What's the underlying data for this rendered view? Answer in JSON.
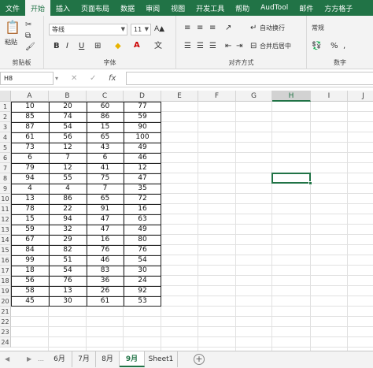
{
  "ribbon_tabs": [
    "文件",
    "开始",
    "插入",
    "页面布局",
    "数据",
    "审阅",
    "视图",
    "开发工具",
    "帮助",
    "AudTool",
    "邮件",
    "方方格子"
  ],
  "active_tab": 1,
  "clipboard": {
    "paste": "粘贴",
    "label": "剪贴板"
  },
  "font": {
    "name": "等线",
    "size": "11",
    "bold": "B",
    "italic": "I",
    "underline": "U",
    "label": "字体"
  },
  "alignment": {
    "wrap": "自动换行",
    "merge": "合并后居中",
    "label": "对齐方式"
  },
  "number": {
    "format": "常规",
    "label": "数字"
  },
  "name_box": "H8",
  "fx_label": "fx",
  "columns": [
    "A",
    "B",
    "C",
    "D",
    "E",
    "F",
    "G",
    "H",
    "I",
    "J"
  ],
  "selected_column": "H",
  "rows": [
    "1",
    "2",
    "3",
    "4",
    "5",
    "6",
    "7",
    "8",
    "9",
    "10",
    "11",
    "12",
    "13",
    "14",
    "15",
    "16",
    "17",
    "18",
    "19",
    "20",
    "21",
    "22",
    "23",
    "24"
  ],
  "table": [
    [
      10,
      20,
      60,
      77
    ],
    [
      85,
      74,
      86,
      59
    ],
    [
      87,
      54,
      15,
      90
    ],
    [
      61,
      56,
      65,
      100
    ],
    [
      73,
      12,
      43,
      49
    ],
    [
      6,
      7,
      6,
      46
    ],
    [
      79,
      12,
      41,
      12
    ],
    [
      94,
      55,
      75,
      47
    ],
    [
      4,
      4,
      7,
      35
    ],
    [
      13,
      86,
      65,
      72
    ],
    [
      78,
      22,
      91,
      16
    ],
    [
      15,
      94,
      47,
      63
    ],
    [
      59,
      32,
      47,
      49
    ],
    [
      67,
      29,
      16,
      80
    ],
    [
      84,
      82,
      76,
      76
    ],
    [
      99,
      51,
      46,
      54
    ],
    [
      18,
      54,
      83,
      30
    ],
    [
      56,
      76,
      36,
      24
    ],
    [
      58,
      13,
      26,
      92
    ],
    [
      45,
      30,
      61,
      53
    ]
  ],
  "sheets": [
    "6月",
    "7月",
    "8月",
    "9月",
    "Sheet1"
  ],
  "active_sheet": 3,
  "accent_color": "#217346"
}
